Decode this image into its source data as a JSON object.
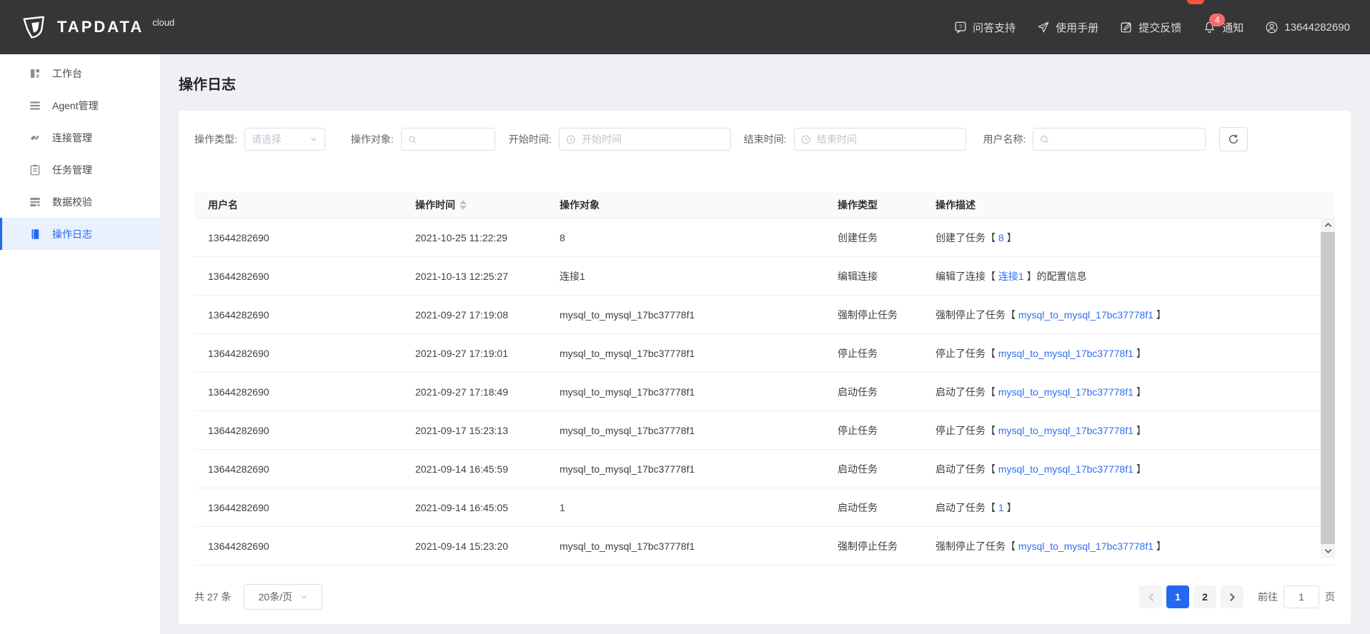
{
  "colors": {
    "accent": "#2368f1",
    "link": "#2f6ff2",
    "badge": "#f56c6c",
    "header_bg": "#363636",
    "active_item_bg": "#e9f1fd",
    "page_bg": "#eef0f4"
  },
  "header": {
    "brand": {
      "name": "TAPDATA",
      "suffix": "cloud"
    },
    "nav": [
      {
        "label": "问答支持",
        "icon": "question-icon"
      },
      {
        "label": "使用手册",
        "icon": "paper-plane-icon"
      },
      {
        "label": "提交反馈",
        "icon": "feedback-icon"
      },
      {
        "label": "通知",
        "icon": "bell-icon",
        "badge": "4"
      },
      {
        "label": "13644282690",
        "icon": "user-icon"
      }
    ]
  },
  "sidebar": {
    "items": [
      {
        "label": "工作台",
        "icon": "dashboard-icon"
      },
      {
        "label": "Agent管理",
        "icon": "agent-list-icon"
      },
      {
        "label": "连接管理",
        "icon": "connection-icon"
      },
      {
        "label": "任务管理",
        "icon": "task-clipboard-icon"
      },
      {
        "label": "数据校验",
        "icon": "data-validation-icon"
      },
      {
        "label": "操作日志",
        "icon": "operation-log-icon",
        "active": true
      }
    ]
  },
  "page": {
    "title": "操作日志"
  },
  "filters": {
    "operation_type": {
      "label": "操作类型:",
      "placeholder": "请选择"
    },
    "operation_object": {
      "label": "操作对象:",
      "placeholder": ""
    },
    "start_time": {
      "label": "开始时间:",
      "placeholder": "开始时间"
    },
    "end_time": {
      "label": "结束时间:",
      "placeholder": "结束时间"
    },
    "user_name": {
      "label": "用户名称:",
      "placeholder": ""
    }
  },
  "table": {
    "columns": {
      "user": "用户名",
      "time": "操作时间",
      "object": "操作对象",
      "type": "操作类型",
      "desc": "操作描述"
    },
    "rows": [
      {
        "user": "13644282690",
        "time": "2021-10-25 11:22:29",
        "object": "8",
        "type": "创建任务",
        "desc": {
          "prefix": "创建了任务【 ",
          "link": "8",
          "suffix": " 】"
        }
      },
      {
        "user": "13644282690",
        "time": "2021-10-13 12:25:27",
        "object": "连接1",
        "type": "编辑连接",
        "desc": {
          "prefix": "编辑了连接【 ",
          "link": "连接1",
          "suffix": " 】的配置信息"
        }
      },
      {
        "user": "13644282690",
        "time": "2021-09-27 17:19:08",
        "object": "mysql_to_mysql_17bc37778f1",
        "type": "强制停止任务",
        "desc": {
          "prefix": "强制停止了任务【 ",
          "link": "mysql_to_mysql_17bc37778f1",
          "suffix": " 】"
        }
      },
      {
        "user": "13644282690",
        "time": "2021-09-27 17:19:01",
        "object": "mysql_to_mysql_17bc37778f1",
        "type": "停止任务",
        "desc": {
          "prefix": "停止了任务【 ",
          "link": "mysql_to_mysql_17bc37778f1",
          "suffix": " 】"
        }
      },
      {
        "user": "13644282690",
        "time": "2021-09-27 17:18:49",
        "object": "mysql_to_mysql_17bc37778f1",
        "type": "启动任务",
        "desc": {
          "prefix": "启动了任务【 ",
          "link": "mysql_to_mysql_17bc37778f1",
          "suffix": " 】"
        }
      },
      {
        "user": "13644282690",
        "time": "2021-09-17 15:23:13",
        "object": "mysql_to_mysql_17bc37778f1",
        "type": "停止任务",
        "desc": {
          "prefix": "停止了任务【 ",
          "link": "mysql_to_mysql_17bc37778f1",
          "suffix": " 】"
        }
      },
      {
        "user": "13644282690",
        "time": "2021-09-14 16:45:59",
        "object": "mysql_to_mysql_17bc37778f1",
        "type": "启动任务",
        "desc": {
          "prefix": "启动了任务【 ",
          "link": "mysql_to_mysql_17bc37778f1",
          "suffix": " 】"
        }
      },
      {
        "user": "13644282690",
        "time": "2021-09-14 16:45:05",
        "object": "1",
        "type": "启动任务",
        "desc": {
          "prefix": "启动了任务【 ",
          "link": "1",
          "suffix": " 】"
        }
      },
      {
        "user": "13644282690",
        "time": "2021-09-14 15:23:20",
        "object": "mysql_to_mysql_17bc37778f1",
        "type": "强制停止任务",
        "desc": {
          "prefix": "强制停止了任务【 ",
          "link": "mysql_to_mysql_17bc37778f1",
          "suffix": " 】"
        }
      }
    ]
  },
  "pagination": {
    "total": "共 27 条",
    "page_size": "20条/页",
    "pages": [
      "1",
      "2"
    ],
    "active_page": "1",
    "goto_label": "前往",
    "goto_value": "1",
    "goto_suffix": "页"
  }
}
